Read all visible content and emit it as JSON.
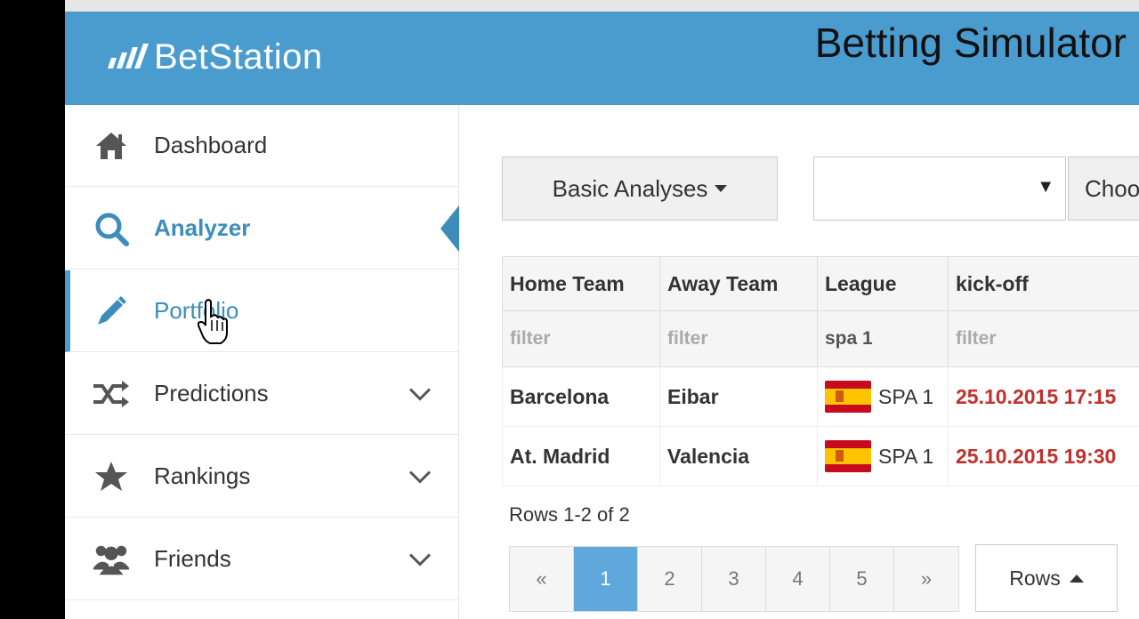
{
  "header": {
    "brand": "BetStation",
    "title": "Betting Simulator"
  },
  "sidebar": {
    "items": [
      {
        "label": "Dashboard",
        "icon": "home-icon"
      },
      {
        "label": "Analyzer",
        "icon": "search-icon"
      },
      {
        "label": "Portfolio",
        "icon": "pencil-icon"
      },
      {
        "label": "Predictions",
        "icon": "shuffle-icon"
      },
      {
        "label": "Rankings",
        "icon": "star-icon"
      },
      {
        "label": "Friends",
        "icon": "users-icon"
      }
    ]
  },
  "toolbar": {
    "analyses_label": "Basic Analyses",
    "select_value": "",
    "choose_label": "Choo"
  },
  "table": {
    "headers": [
      "Home Team",
      "Away Team",
      "League",
      "kick-off"
    ],
    "filters": [
      "filter",
      "filter",
      "spa 1",
      "filter"
    ],
    "rows": [
      {
        "home": "Barcelona",
        "away": "Eibar",
        "league": "SPA 1",
        "kickoff": "25.10.2015 17:15"
      },
      {
        "home": "At. Madrid",
        "away": "Valencia",
        "league": "SPA 1",
        "kickoff": "25.10.2015 19:30"
      }
    ]
  },
  "rows_info": "Rows 1-2 of 2",
  "pager": {
    "prev": "«",
    "pages": [
      "1",
      "2",
      "3",
      "4",
      "5"
    ],
    "next": "»",
    "current": "1"
  },
  "rows_button": "Rows",
  "colors": {
    "brand": "#4a9ccf",
    "accent": "#3c8dbc",
    "kickoff": "#c0312d"
  }
}
